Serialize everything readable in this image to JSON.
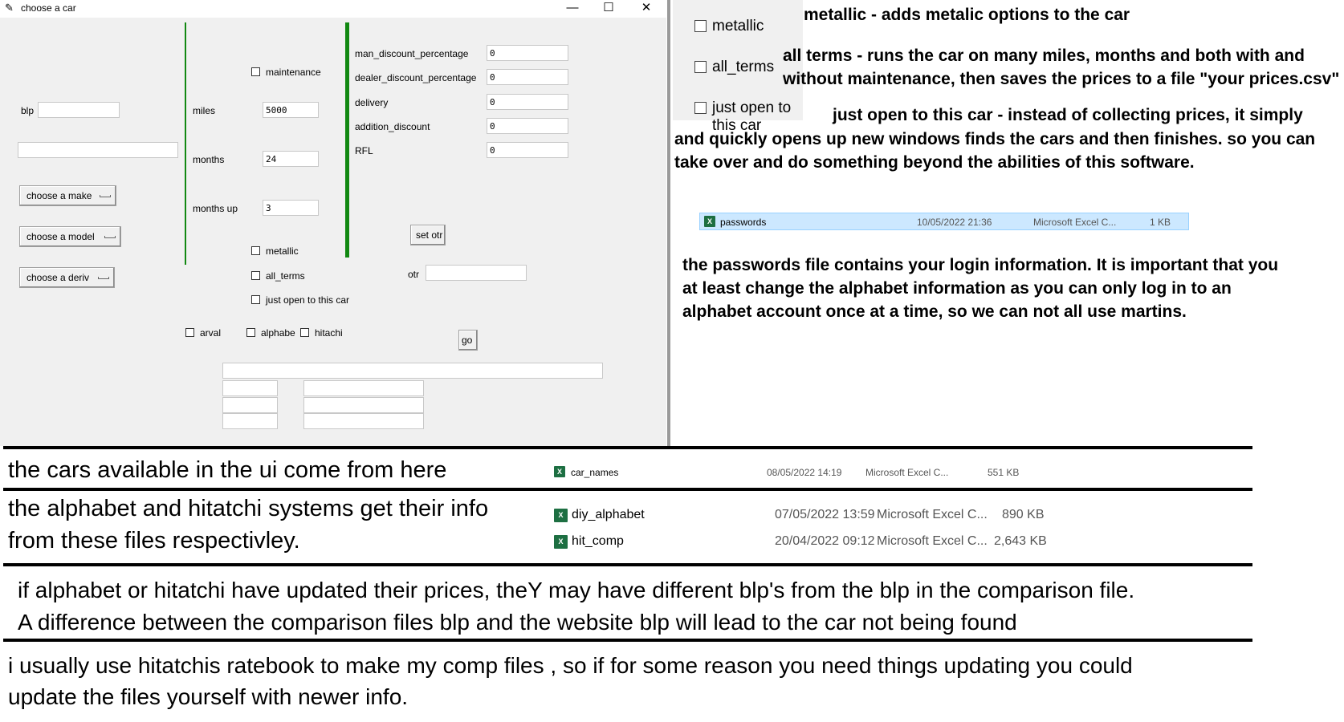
{
  "window": {
    "title": "choose a car",
    "minimize_glyph": "—",
    "maximize_glyph": "☐",
    "close_glyph": "✕"
  },
  "form": {
    "blp_label": "blp",
    "blp_value": "",
    "search_value": "",
    "make_button": "choose a make",
    "model_button": "choose a model",
    "deriv_button": "choose a deriv",
    "maintenance_label": "maintenance",
    "miles_label": "miles",
    "miles_value": "5000",
    "months_label": "months",
    "months_value": "24",
    "months_up_label": "months up",
    "months_up_value": "3",
    "metallic_label": "metallic",
    "all_terms_label": "all_terms",
    "just_open_label": "just open to this car",
    "man_discount_label": "man_discount_percentage",
    "man_discount_value": "0",
    "dealer_discount_label": "dealer_discount_percentage",
    "dealer_discount_value": "0",
    "delivery_label": "delivery",
    "delivery_value": "0",
    "addition_discount_label": "addition_discount",
    "addition_discount_value": "0",
    "rfl_label": "RFL",
    "rfl_value": "0",
    "set_otr_button": "set otr",
    "otr_label": "otr",
    "otr_value": "",
    "arval_label": "arval",
    "alphabe_label": "alphabe",
    "hitachi_label": "hitachi",
    "go_button": "go"
  },
  "zoom_checkboxes": {
    "metallic": "metallic",
    "all_terms": "all_terms",
    "just_open": "just open to this car"
  },
  "notes": {
    "metallic": "metallic - adds metalic options to the car",
    "all_terms_line1": "all terms - runs the car on many miles, months and both with and",
    "all_terms_line2": "without maintenance, then saves the prices to a file \"your prices.csv\"",
    "just_open_line1": "just open to this car - instead of collecting prices, it simply",
    "just_open_line2": "and quickly opens up new windows finds the cars and then finishes. so you can",
    "just_open_line3": "take over and do something beyond the abilities of this software.",
    "passwords_line1": "the passwords file contains your login information. It is important that you",
    "passwords_line2": "at least change the alphabet information as you can only log in to an",
    "passwords_line3": "alphabet account once at a time, so we can not all use martins."
  },
  "passwords_file": {
    "name": "passwords",
    "date": "10/05/2022 21:36",
    "type": "Microsoft Excel C...",
    "size": "1 KB"
  },
  "car_names_file": {
    "note": "the cars available in the ui come from here",
    "name": "car_names",
    "date": "08/05/2022 14:19",
    "type": "Microsoft Excel C...",
    "size": "551 KB"
  },
  "source_files": {
    "note_line1": "the alphabet and hitatchi systems get their info",
    "note_line2": "from these files respectivley.",
    "files": [
      {
        "name": "diy_alphabet",
        "date": "07/05/2022 13:59",
        "type": "Microsoft Excel C...",
        "size": "890 KB"
      },
      {
        "name": "hit_comp",
        "date": "20/04/2022 09:12",
        "type": "Microsoft Excel C...",
        "size": "2,643 KB"
      }
    ]
  },
  "blp_note": {
    "line1": "if alphabet or hitatchi have updated their prices, theY  may have different blp's from the blp in the comparison file.",
    "line2": "A difference between the comparison files blp and the website blp will lead to the car not being found"
  },
  "ratebook_note": {
    "line1": "i usually use hitatchis ratebook to make my comp files , so if for some reason you need things updating you could",
    "line2": "update the files yourself with newer info."
  },
  "icons": {
    "app": "feather-icon",
    "excel": "excel-file-icon"
  },
  "colors": {
    "window_bg": "#f0f0f0",
    "separator_green": "#118811",
    "selection_bg": "#cce8ff",
    "excel_green": "#1d6f42"
  }
}
